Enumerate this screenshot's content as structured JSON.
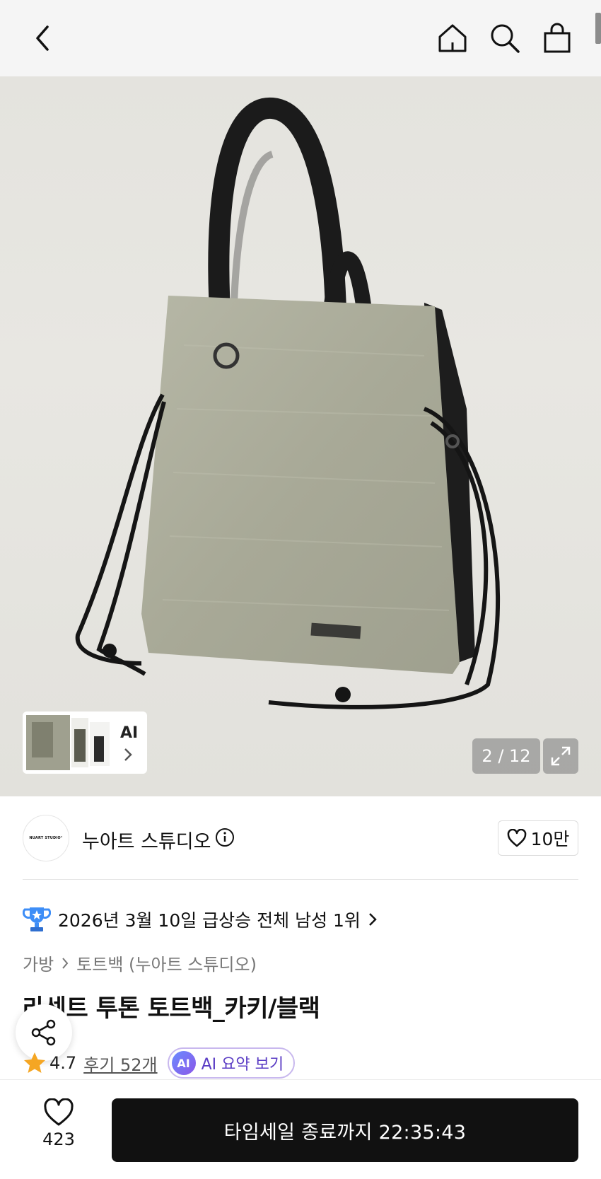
{
  "header": {
    "icons": [
      "back-icon",
      "home-icon",
      "search-icon",
      "cart-icon"
    ]
  },
  "gallery": {
    "ai_label": "AI",
    "counter": "2 / 12",
    "expand_icon": "expand-icon"
  },
  "brand": {
    "logo_text": "NUART STUDIO°",
    "name": "누아트 스튜디오",
    "like_count": "10만"
  },
  "ranking": {
    "text": "2026년 3월 10일 급상승 전체 남성 1위"
  },
  "breadcrumb": {
    "category": "가방",
    "subcategory": "토트백 (누아트 스튜디오)"
  },
  "product": {
    "title": "라센트 투톤 토트백_카키/블랙",
    "rating": "4.7",
    "reviews": "후기 52개",
    "ai_badge": "AI",
    "ai_summary": "AI 요약 보기"
  },
  "bottom": {
    "wish_count": "423",
    "cta": "타임세일 종료까지 22:35:43"
  },
  "colors": {
    "cta_bg": "#111111",
    "ai_accent": "#5a3cc4",
    "star": "#f5a623"
  }
}
